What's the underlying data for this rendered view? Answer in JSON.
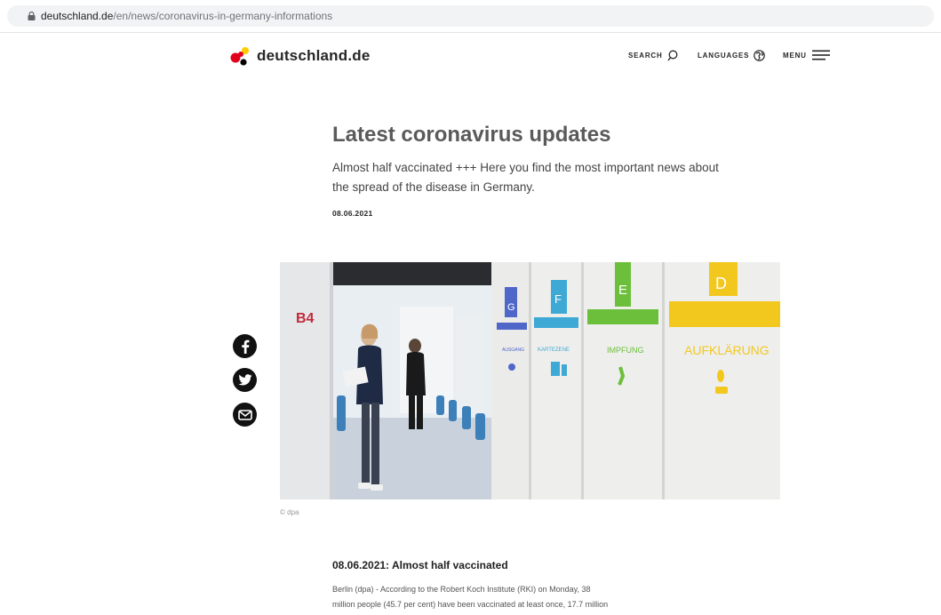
{
  "browser": {
    "url_domain": "deutschland.de",
    "url_path": "/en/news/coronavirus-in-germany-informations"
  },
  "header": {
    "logo_text": "deutschland.de",
    "nav": {
      "search": "SEARCH",
      "languages": "LANGUAGES",
      "menu": "MENU"
    }
  },
  "article": {
    "headline": "Latest coronavirus updates",
    "teaser": "Almost half vaccinated +++ Here you find the most important news about the spread of the disease in Germany.",
    "date": "08.06.2021",
    "image": {
      "credit": "© dpa",
      "signs": {
        "hall": "B4",
        "letter_g": "G",
        "letter_f": "F",
        "letter_e": "E",
        "letter_d": "D",
        "word_g": "AUSGANG",
        "word_f": "KARTEZENE",
        "word_e": "IMPFUNG",
        "word_d": "AUFKLÄRUNG"
      }
    },
    "section_title": "08.06.2021: Almost half vaccinated",
    "body_line1": "Berlin (dpa) - According to the Robert Koch Institute (RKI) on Monday, 38",
    "body_line2": "million people (45.7 per cent) have been vaccinated at least once, 17.7 million"
  },
  "share": {
    "icons": [
      "facebook-icon",
      "twitter-icon",
      "email-icon"
    ]
  },
  "colors": {
    "logo_red": "#e2001a",
    "logo_yellow": "#ffcc00",
    "logo_black": "#000000",
    "sign_blue": "#4f67c9",
    "sign_cyan": "#3fa9d6",
    "sign_green": "#6cbf3a",
    "sign_yellow": "#f2c81f"
  }
}
